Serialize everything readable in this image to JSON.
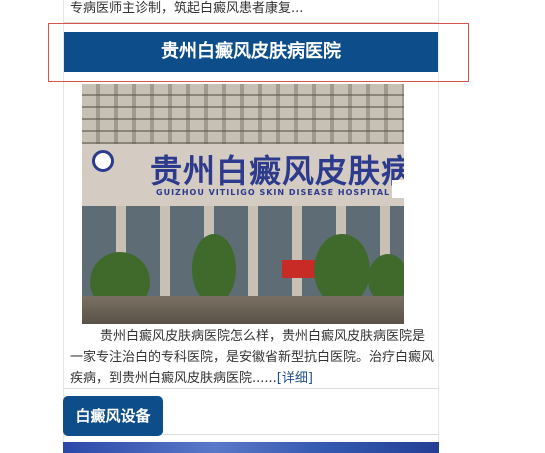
{
  "top_strip": {
    "text": "专病医师主诊制，筑起白癜风患者康复..."
  },
  "hospital_card": {
    "title": "贵州白癜风皮肤病医院",
    "image": {
      "sign_text": "贵州白癜风皮肤病医院",
      "sign_subtext": "GUIZHOU VITILIGO SKIN DISEASE HOSPITAL"
    },
    "description": "贵州白癜风皮肤病医院怎么样，贵州白癜风皮肤病医院是一家专注治白的专科医院，是安徽省新型抗白医院。治疗白癜风疾病，到贵州白癜风皮肤病医院......",
    "more_link": "[详细]"
  },
  "equipment_section": {
    "tab_label": "白癜风设备"
  },
  "colors": {
    "brand_blue": "#0d4e8a",
    "highlight_red": "#d9534f",
    "link_blue": "#1b4f8d"
  }
}
